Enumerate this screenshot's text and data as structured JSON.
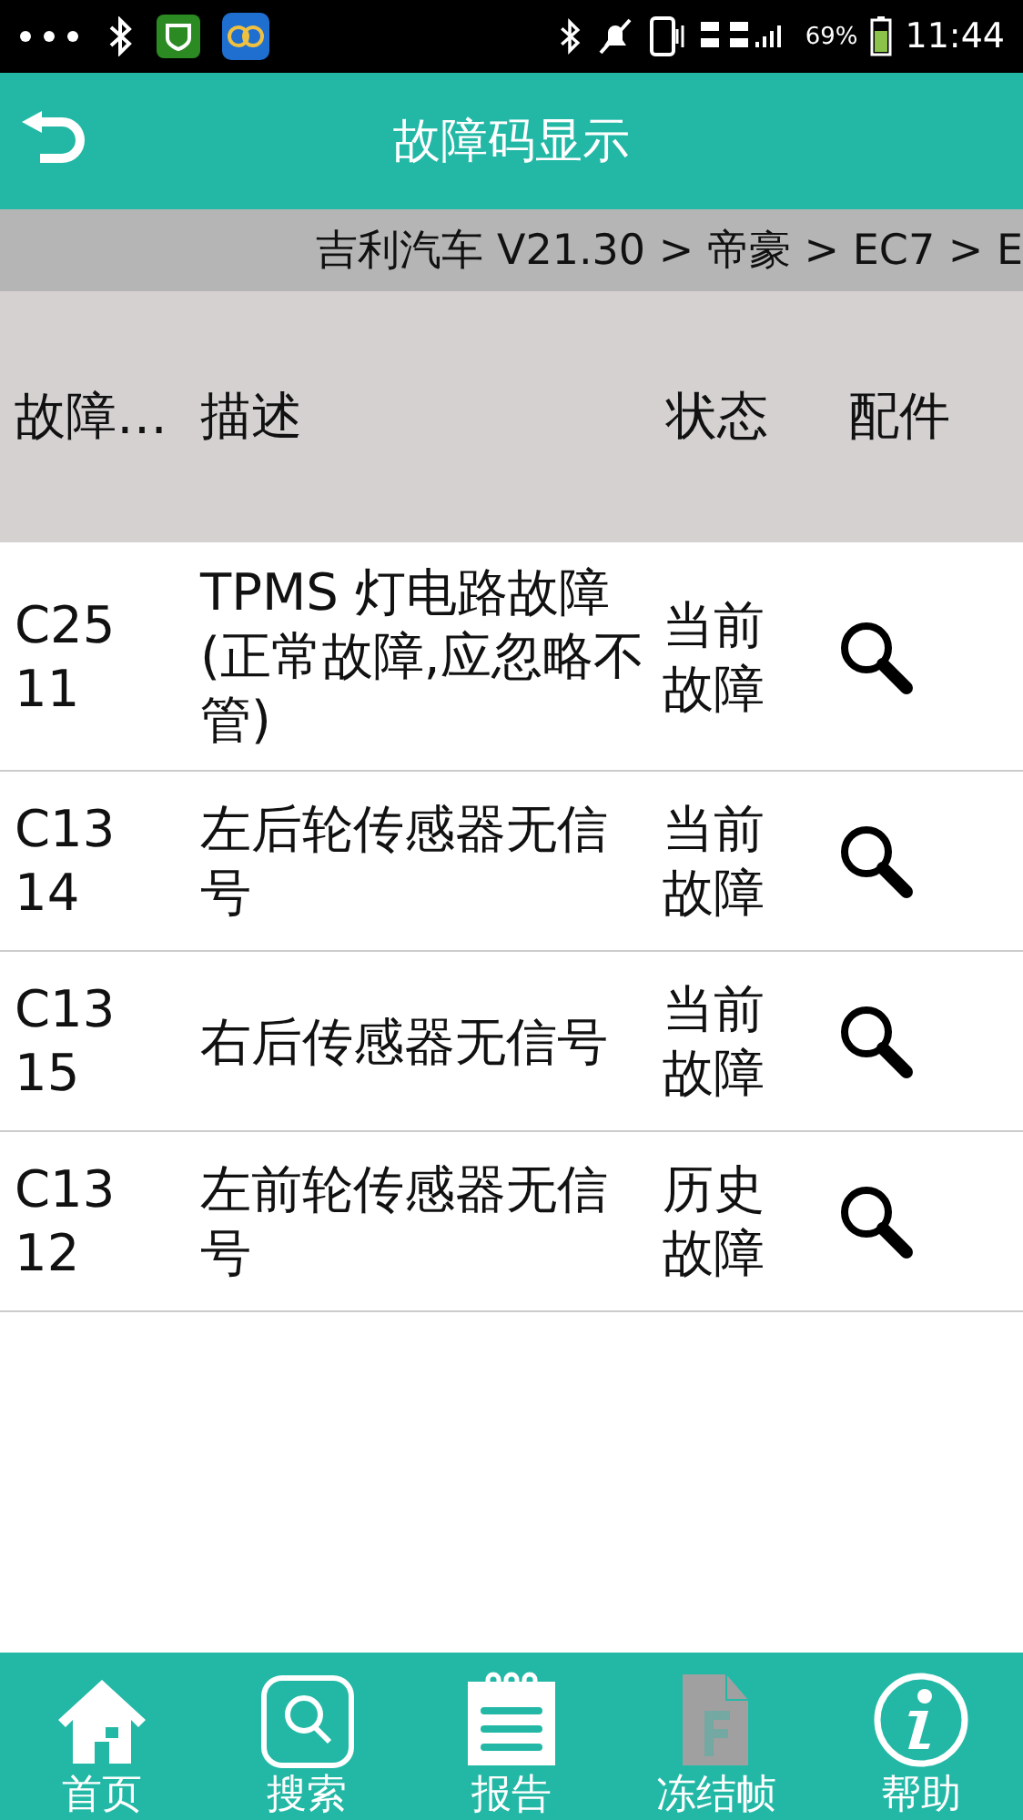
{
  "status_bar": {
    "battery": "69%",
    "time": "11:44"
  },
  "header": {
    "title": "故障码显示"
  },
  "breadcrumb": "吉利汽车 V21.30 > 帝豪 > EC7 > E",
  "table": {
    "columns": [
      "故障…",
      "描述",
      "状态",
      "配件"
    ],
    "rows": [
      {
        "code": "C2511",
        "description": "TPMS 灯电路故障(正常故障,应忽略不管)",
        "status": "当前故障"
      },
      {
        "code": "C1314",
        "description": "左后轮传感器无信号",
        "status": "当前故障"
      },
      {
        "code": "C1315",
        "description": "右后传感器无信号",
        "status": "当前故障"
      },
      {
        "code": "C1312",
        "description": "左前轮传感器无信号",
        "status": "历史故障"
      }
    ]
  },
  "nav": [
    {
      "kind": "home",
      "label": "首页",
      "disabled": false
    },
    {
      "kind": "search",
      "label": "搜索",
      "disabled": false
    },
    {
      "kind": "report",
      "label": "报告",
      "disabled": false
    },
    {
      "kind": "freeze",
      "label": "冻结帧",
      "disabled": true
    },
    {
      "kind": "help",
      "label": "帮助",
      "disabled": false
    }
  ]
}
